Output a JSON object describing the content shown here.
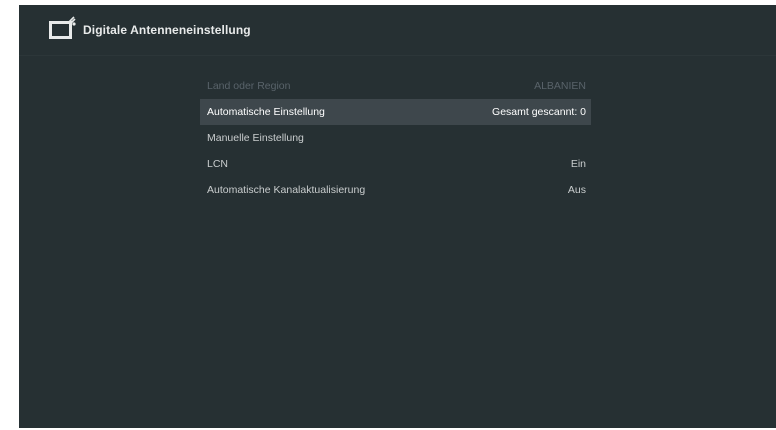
{
  "header": {
    "title": "Digitale Antenneneinstellung",
    "icon": "tv-antenna-icon"
  },
  "colors": {
    "background": "#263033",
    "selected_row": "#3e474c",
    "disabled_text": "#59636a",
    "text": "#c9cdce"
  },
  "menu": {
    "items": [
      {
        "label": "Land oder Region",
        "value": "ALBANIEN",
        "state": "disabled"
      },
      {
        "label": "Automatische Einstellung",
        "value": "Gesamt gescannt: 0",
        "state": "selected"
      },
      {
        "label": "Manuelle Einstellung",
        "value": "",
        "state": "normal"
      },
      {
        "label": "LCN",
        "value": "Ein",
        "state": "normal"
      },
      {
        "label": "Automatische Kanalaktualisierung",
        "value": "Aus",
        "state": "normal"
      }
    ]
  }
}
